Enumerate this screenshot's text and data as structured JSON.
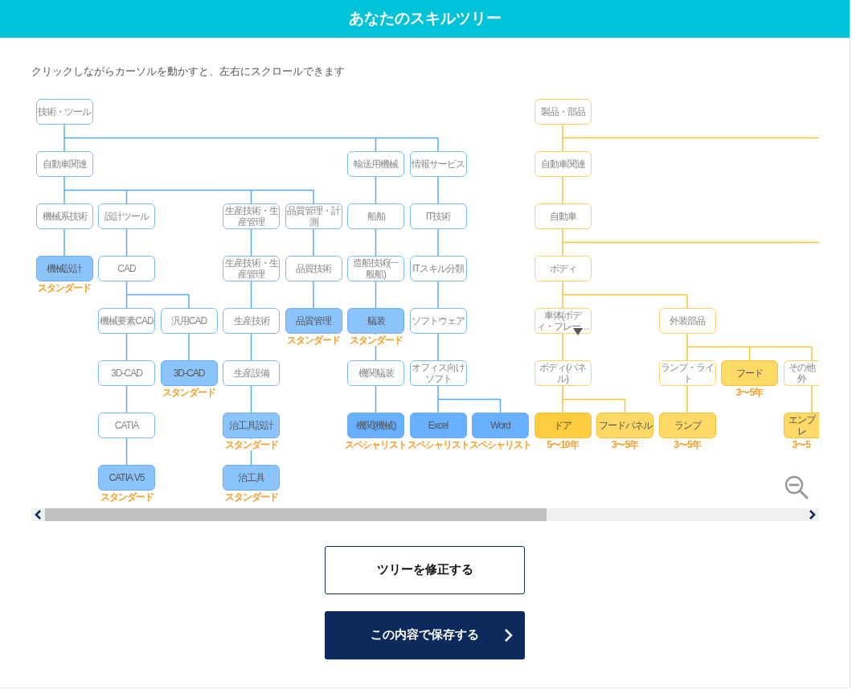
{
  "header": {
    "title": "あなたのスキルツリー"
  },
  "instruction": "クリックしながらカーソルを動かすと、左右にスクロールできます",
  "trees": [
    {
      "kind": "tech",
      "nodes": [
        {
          "label": "技術・ツール",
          "filled": false,
          "children": [
            {
              "label": "自動車関連",
              "filled": false,
              "children": [
                {
                  "label": "機械系技術",
                  "filled": false,
                  "children": [
                    {
                      "label": "機械設計",
                      "filled": true,
                      "color": "#8cc4fd",
                      "badge": "スタンダード"
                    }
                  ]
                },
                {
                  "label": "設計ツール",
                  "filled": false,
                  "children": [
                    {
                      "label": "CAD",
                      "filled": false,
                      "children": [
                        {
                          "label": "機械要素CAD",
                          "filled": false,
                          "children": [
                            {
                              "label": "3D-CAD",
                              "filled": false,
                              "children": [
                                {
                                  "label": "CATIA",
                                  "filled": false,
                                  "children": [
                                    {
                                      "label": "CATIA V5",
                                      "filled": true,
                                      "color": "#8cc4fd",
                                      "badge": "スタンダード"
                                    }
                                  ]
                                }
                              ]
                            }
                          ]
                        },
                        {
                          "label": "汎用CAD",
                          "filled": false,
                          "children": [
                            {
                              "label": "3D-CAD",
                              "filled": true,
                              "color": "#8cc4fd",
                              "badge": "スタンダード"
                            }
                          ]
                        }
                      ]
                    }
                  ]
                },
                {
                  "label": "生産技術・生産管理",
                  "filled": false,
                  "children": [
                    {
                      "label": "生産技術・生産管理",
                      "filled": false,
                      "children": [
                        {
                          "label": "生産技術",
                          "filled": false,
                          "children": [
                            {
                              "label": "生産設備",
                              "filled": false,
                              "children": [
                                {
                                  "label": "治工具設計",
                                  "filled": true,
                                  "color": "#8cc4fd",
                                  "badge": "スタンダード",
                                  "children": [
                                    {
                                      "label": "治工具",
                                      "filled": true,
                                      "color": "#8cc4fd",
                                      "badge": "スタンダード"
                                    }
                                  ]
                                }
                              ]
                            }
                          ]
                        }
                      ]
                    }
                  ]
                },
                {
                  "label": "品質管理・計測",
                  "filled": false,
                  "children": [
                    {
                      "label": "品質技術",
                      "filled": false,
                      "children": [
                        {
                          "label": "品質管理",
                          "filled": true,
                          "color": "#8cc4fd",
                          "badge": "スタンダード"
                        }
                      ]
                    }
                  ]
                }
              ]
            },
            {
              "label": "輸送用機械",
              "filled": false,
              "children": [
                {
                  "label": "船舶",
                  "filled": false,
                  "children": [
                    {
                      "label": "造船技術(一般船)",
                      "filled": false,
                      "children": [
                        {
                          "label": "艤装",
                          "filled": true,
                          "color": "#8cc4fd",
                          "badge": "スタンダード",
                          "children": [
                            {
                              "label": "機関艤装",
                              "filled": false,
                              "children": [
                                {
                                  "label": "機関(機械)",
                                  "filled": true,
                                  "color": "#66b0ff",
                                  "badge": "スペシャリスト"
                                }
                              ]
                            }
                          ]
                        }
                      ]
                    }
                  ]
                }
              ]
            },
            {
              "label": "情報サービス",
              "filled": false,
              "children": [
                {
                  "label": "IT技術",
                  "filled": false,
                  "children": [
                    {
                      "label": "ITスキル分類",
                      "filled": false,
                      "children": [
                        {
                          "label": "ソフトウェア",
                          "filled": false,
                          "children": [
                            {
                              "label": "オフィス向けソフト",
                              "filled": false,
                              "children": [
                                {
                                  "label": "Excel",
                                  "filled": true,
                                  "color": "#66b0ff",
                                  "badge": "スペシャリスト"
                                },
                                {
                                  "label": "Word",
                                  "filled": true,
                                  "color": "#66b0ff",
                                  "badge": "スペシャリスト"
                                }
                              ]
                            }
                          ]
                        }
                      ]
                    }
                  ]
                }
              ]
            }
          ]
        }
      ]
    },
    {
      "kind": "product",
      "nodes": [
        {
          "label": "製品・部品",
          "filled": false,
          "more_right": true,
          "children": [
            {
              "label": "自動車関連",
              "filled": false,
              "children": [
                {
                  "label": "自動車",
                  "filled": false,
                  "more_right": true,
                  "children": [
                    {
                      "label": "ボディ",
                      "filled": false,
                      "children": [
                        {
                          "label": "車体(ボディ・フレー…",
                          "filled": false,
                          "menu": true,
                          "children": [
                            {
                              "label": "ボディ(パネル)",
                              "filled": false,
                              "children": [
                                {
                                  "label": "ドア",
                                  "filled": true,
                                  "color": "#ffcc3d",
                                  "badge": "5〜10年"
                                },
                                {
                                  "label": "フードパネル",
                                  "filled": true,
                                  "color": "#ffd966",
                                  "badge": "3〜5年"
                                }
                              ]
                            }
                          ]
                        },
                        {
                          "label": "外装部品",
                          "filled": false,
                          "children": [
                            {
                              "label": "ランプ・ライト",
                              "filled": false,
                              "children": [
                                {
                                  "label": "ランプ",
                                  "filled": true,
                                  "color": "#ffd966",
                                  "badge": "3〜5年"
                                }
                              ]
                            },
                            {
                              "label": "フード",
                              "filled": true,
                              "color": "#ffd966",
                              "badge": "3〜5年"
                            },
                            {
                              "label": "その他外",
                              "filled": false,
                              "children": [
                                {
                                  "label": "エンブレ",
                                  "filled": true,
                                  "color": "#ffd966",
                                  "badge": "3〜5"
                                }
                              ]
                            }
                          ]
                        }
                      ]
                    }
                  ]
                }
              ]
            }
          ]
        }
      ]
    }
  ],
  "buttons": [
    {
      "kind": "secondary",
      "label": "ツリーを修正する"
    },
    {
      "kind": "primary",
      "label": "この内容で保存する"
    }
  ]
}
